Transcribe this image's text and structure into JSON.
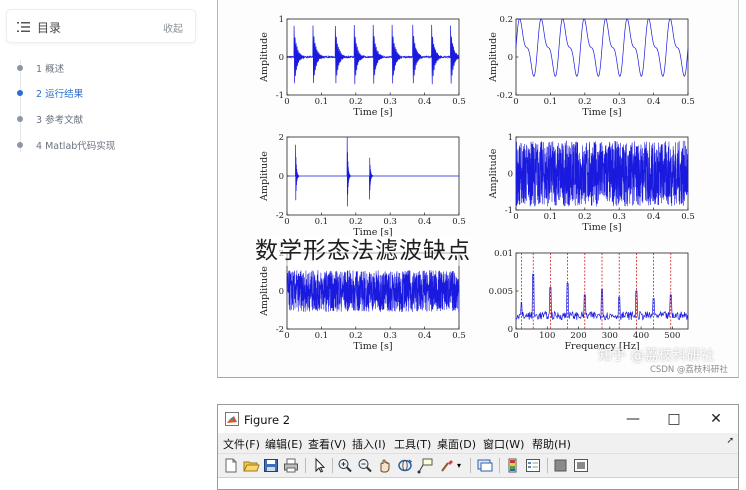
{
  "toc": {
    "title": "目录",
    "collapse_label": "收起",
    "items": [
      {
        "label": "1 概述",
        "active": false
      },
      {
        "label": "2 运行结果",
        "active": true
      },
      {
        "label": "3 参考文献",
        "active": false
      },
      {
        "label": "4 Matlab代码实现",
        "active": false
      }
    ]
  },
  "overlay_text": "数学形态法滤波缺点",
  "watermark": {
    "zhihu": "知乎 @荔枝科研社",
    "csdn": "CSDN @荔枝科研社"
  },
  "figure2": {
    "title": "Figure 2",
    "menu": [
      "文件(F)",
      "编辑(E)",
      "查看(V)",
      "插入(I)",
      "工具(T)",
      "桌面(D)",
      "窗口(W)",
      "帮助(H)"
    ],
    "toolbar_icons": [
      "new-figure-icon",
      "open-file-icon",
      "save-icon",
      "print-icon",
      "pointer-icon",
      "zoom-in-icon",
      "zoom-out-icon",
      "pan-icon",
      "rotate-3d-icon",
      "data-cursor-icon",
      "brush-icon",
      "link-plot-icon",
      "colorbar-icon",
      "legend-icon",
      "hide-plot-tools-icon",
      "show-plot-tools-icon"
    ]
  },
  "chart_data": [
    {
      "type": "line",
      "xlabel": "Time [s]",
      "ylabel": "Amplitude",
      "xlim": [
        0,
        0.5
      ],
      "ylim": [
        -1,
        1
      ],
      "xticks": [
        0,
        0.1,
        0.2,
        0.3,
        0.4,
        0.5
      ],
      "yticks": [
        -1,
        0,
        1
      ],
      "xtick_labels": [
        "0",
        "0.1",
        "0.2",
        "0.3",
        "0.4",
        "0.5"
      ],
      "ytick_labels": [
        "-1",
        "0",
        "1"
      ],
      "signal": "periodic impulse bursts",
      "burst_times": [
        0.02,
        0.075,
        0.14,
        0.195,
        0.25,
        0.305,
        0.365,
        0.42,
        0.475
      ],
      "burst_amplitude": 0.95
    },
    {
      "type": "line",
      "xlabel": "Time [s]",
      "ylabel": "Amplitude",
      "xlim": [
        0,
        0.5
      ],
      "ylim": [
        -0.2,
        0.2
      ],
      "xticks": [
        0,
        0.1,
        0.2,
        0.3,
        0.4,
        0.5
      ],
      "yticks": [
        -0.2,
        0,
        0.2
      ],
      "xtick_labels": [
        "0",
        "0.1",
        "0.2",
        "0.3",
        "0.4",
        "0.5"
      ],
      "ytick_labels": [
        "-0.2",
        "0",
        "0.2"
      ],
      "signal": "harmonic sum",
      "components": [
        {
          "amp": 0.12,
          "freq": 16
        },
        {
          "amp": 0.055,
          "freq": 32
        }
      ],
      "offset": 0.05
    },
    {
      "type": "line",
      "xlabel": "Time [s]",
      "ylabel": "Amplitude",
      "xlim": [
        0,
        0.5
      ],
      "ylim": [
        -2,
        2
      ],
      "xticks": [
        0,
        0.1,
        0.2,
        0.3,
        0.4,
        0.5
      ],
      "yticks": [
        -2,
        0,
        2
      ],
      "xtick_labels": [
        "0",
        "0.1",
        "0.2",
        "0.3",
        "0.4",
        "0.5"
      ],
      "ytick_labels": [
        "-2",
        "0",
        "2"
      ],
      "signal": "isolated spikes",
      "spike_times": [
        0.025,
        0.175,
        0.24
      ],
      "spike_amplitudes": [
        1.6,
        2.0,
        1.2
      ]
    },
    {
      "type": "line",
      "xlabel": "Time [s]",
      "ylabel": "Amplitude",
      "xlim": [
        0,
        0.5
      ],
      "ylim": [
        -1,
        1
      ],
      "xticks": [
        0,
        0.1,
        0.2,
        0.3,
        0.4,
        0.5
      ],
      "yticks": [
        -1,
        0,
        1
      ],
      "xtick_labels": [
        "0",
        "0.1",
        "0.2",
        "0.3",
        "0.4",
        "0.5"
      ],
      "ytick_labels": [
        "-1",
        "0",
        "1"
      ],
      "signal": "dense noise",
      "noise_amplitude": 0.9
    },
    {
      "type": "line",
      "xlabel": "Time [s]",
      "ylabel": "Amplitude",
      "xlim": [
        0,
        0.5
      ],
      "ylim": [
        -2,
        2
      ],
      "xticks": [
        0,
        0.1,
        0.2,
        0.3,
        0.4,
        0.5
      ],
      "yticks": [
        -2,
        0,
        2
      ],
      "xtick_labels": [
        "0",
        "0.1",
        "0.2",
        "0.3",
        "0.4",
        "0.5"
      ],
      "ytick_labels": [
        "-2",
        "0",
        "2"
      ],
      "signal": "dense noise",
      "noise_amplitude": 1.1
    },
    {
      "type": "line",
      "xlabel": "Frequency [Hz]",
      "ylabel": "",
      "xlim": [
        0,
        550
      ],
      "ylim": [
        0,
        0.01
      ],
      "xticks": [
        0,
        100,
        200,
        300,
        400,
        500
      ],
      "yticks": [
        0,
        0.005,
        0.01
      ],
      "xtick_labels": [
        "0",
        "100",
        "200",
        "300",
        "400",
        "500"
      ],
      "ytick_labels": [
        "0",
        "0.005",
        "0.01"
      ],
      "signal": "envelope spectrum",
      "peak_freqs": [
        18,
        55,
        110,
        165,
        220,
        275,
        330,
        385,
        440,
        495
      ],
      "peak_values": [
        0.0035,
        0.0072,
        0.0055,
        0.006,
        0.0045,
        0.0052,
        0.0042,
        0.005,
        0.004,
        0.0045
      ],
      "baseline": 0.0012,
      "reference_lines_color": "#cc0000"
    }
  ],
  "colors": {
    "signal": "#1a1adf",
    "reference": "#cc0000"
  }
}
